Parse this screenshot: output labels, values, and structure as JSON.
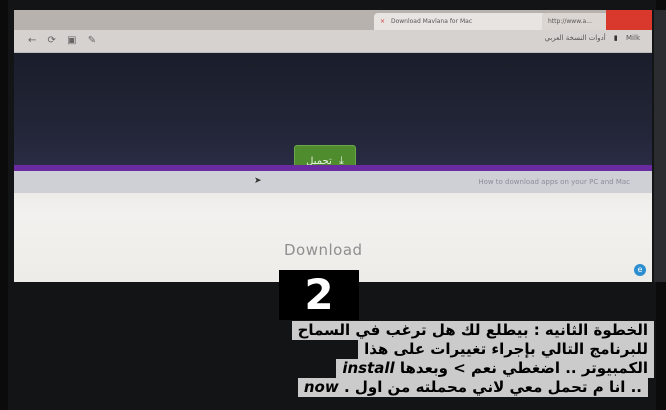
{
  "browser": {
    "tabs": [
      {
        "label": "Download Mavlana for Mac"
      },
      {
        "label": "http://www.a..."
      }
    ],
    "nav_icons": "← ⟳ ▣ ✎",
    "bookmarks": [
      "Milk",
      "أدوات النسخة العربي"
    ]
  },
  "page": {
    "download_button_label": "تحميل",
    "download_button_icon": "⤓",
    "how_to_text": "How to download apps on your PC and Mac",
    "download_text": "Download",
    "corner_icon": "e"
  },
  "overlay": {
    "step_number": "2",
    "caption_lines": [
      "الخطوة الثانيه : بيطلع لك هل ترغب في السماح",
      "للبرنامج التالي بإجراء تغييرات على هذا",
      "الكمبيوتر .. اضغطي نعم > وبعدها install",
      "now .. انا م تحمل معي لاني محملته من اول ."
    ],
    "caption_line3_parts": {
      "arabic": "الكمبيوتر .. اضغطي نعم > وبعدها",
      "english": "install"
    },
    "caption_line4_parts": {
      "english": "now",
      "arabic": ".. انا م تحمل معي لاني محملته من اول ."
    }
  },
  "colors": {
    "download_button": "#4e8c2e",
    "accent_line": "#6a2aa0",
    "window_close": "#d9392c"
  }
}
